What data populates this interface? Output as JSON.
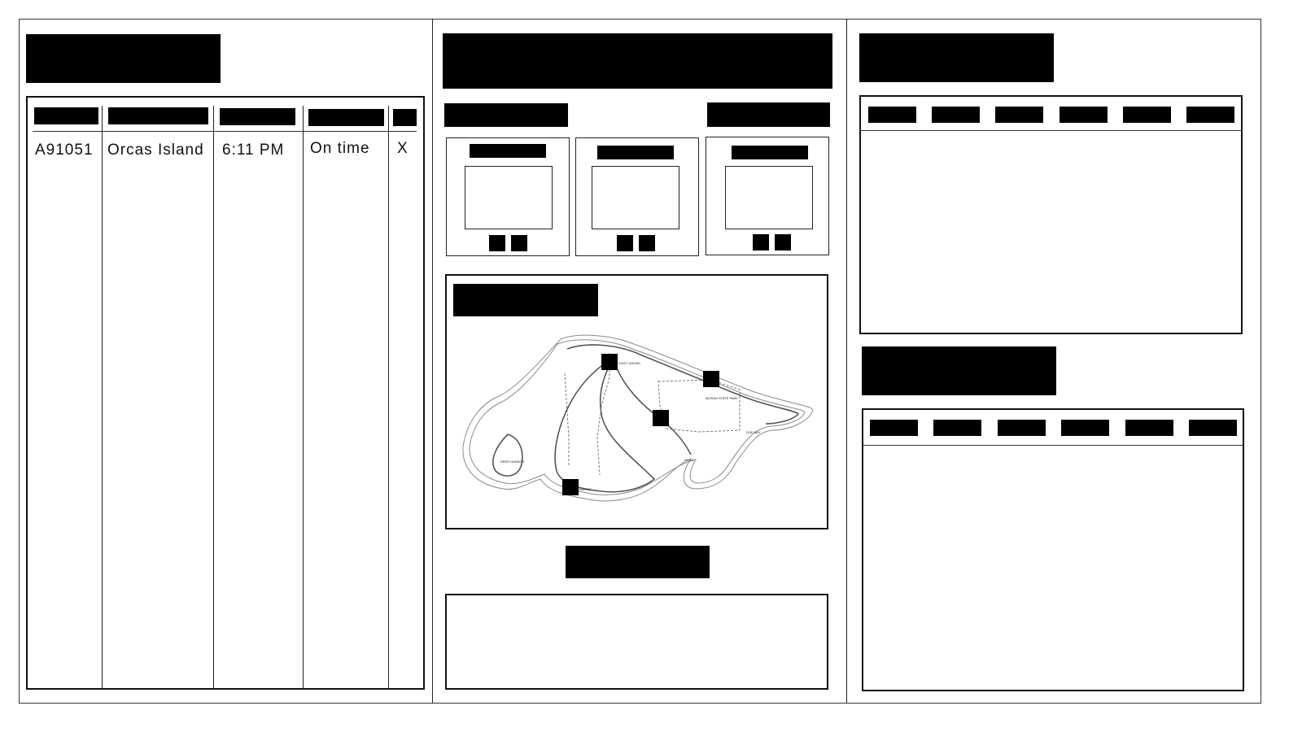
{
  "table": {
    "rows": [
      {
        "id": "A91051",
        "destination": "Orcas Island",
        "time": "6:11 PM",
        "status": "On time",
        "action": "X"
      }
    ]
  },
  "map": {
    "labels": [
      "EAST SOUND",
      "MORAN STATE PARK",
      "DOE BAY",
      "OLGA",
      "DEER HARBOR",
      "LANDING"
    ]
  },
  "colors": {
    "redaction": "#000000",
    "border": "#111111",
    "background": "#ffffff",
    "map_outline": "#666666"
  }
}
